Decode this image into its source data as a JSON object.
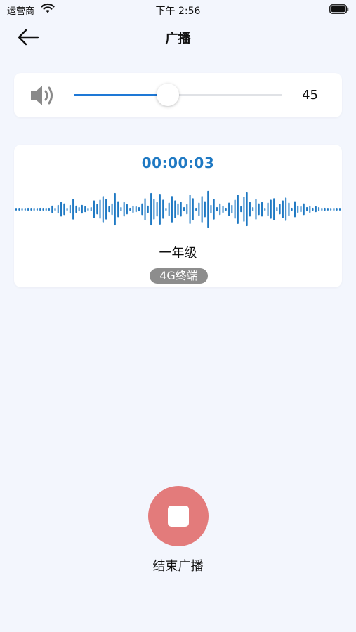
{
  "status_bar": {
    "carrier": "运营商",
    "time": "下午 2:56"
  },
  "nav": {
    "title": "广播",
    "back_icon": "arrow-left-icon"
  },
  "volume": {
    "icon": "speaker-icon",
    "level": 45,
    "max": 100,
    "value_text": "45",
    "accent_color": "#1e78d6"
  },
  "broadcast": {
    "timer": "00:00:03",
    "timer_color": "#1f79c3",
    "waveform_color": "#1f79c3",
    "waveform_bars": [
      1,
      1,
      1,
      1,
      2,
      1,
      2,
      1,
      2,
      1,
      2,
      2,
      5,
      2,
      6,
      10,
      8,
      2,
      6,
      14,
      5,
      3,
      6,
      4,
      2,
      3,
      12,
      7,
      13,
      18,
      14,
      4,
      8,
      22,
      11,
      3,
      10,
      7,
      2,
      5,
      4,
      3,
      8,
      15,
      5,
      22,
      14,
      10,
      21,
      13,
      2,
      9,
      18,
      12,
      8,
      10,
      3,
      7,
      20,
      15,
      2,
      9,
      18,
      11,
      25,
      6,
      14,
      3,
      8,
      5,
      2,
      9,
      6,
      13,
      20,
      4,
      17,
      23,
      10,
      3,
      14,
      8,
      10,
      2,
      9,
      13,
      15,
      3,
      7,
      12,
      16,
      9,
      2,
      11,
      5,
      4,
      8,
      3,
      5,
      2,
      4,
      3,
      2,
      2,
      1,
      1,
      2,
      1,
      1
    ],
    "group_name": "一年级",
    "terminal_badge": "4G终端",
    "badge_color": "#8d8d8d"
  },
  "end": {
    "icon": "stop-icon",
    "label": "结束广播",
    "button_color": "#e37b7b"
  }
}
